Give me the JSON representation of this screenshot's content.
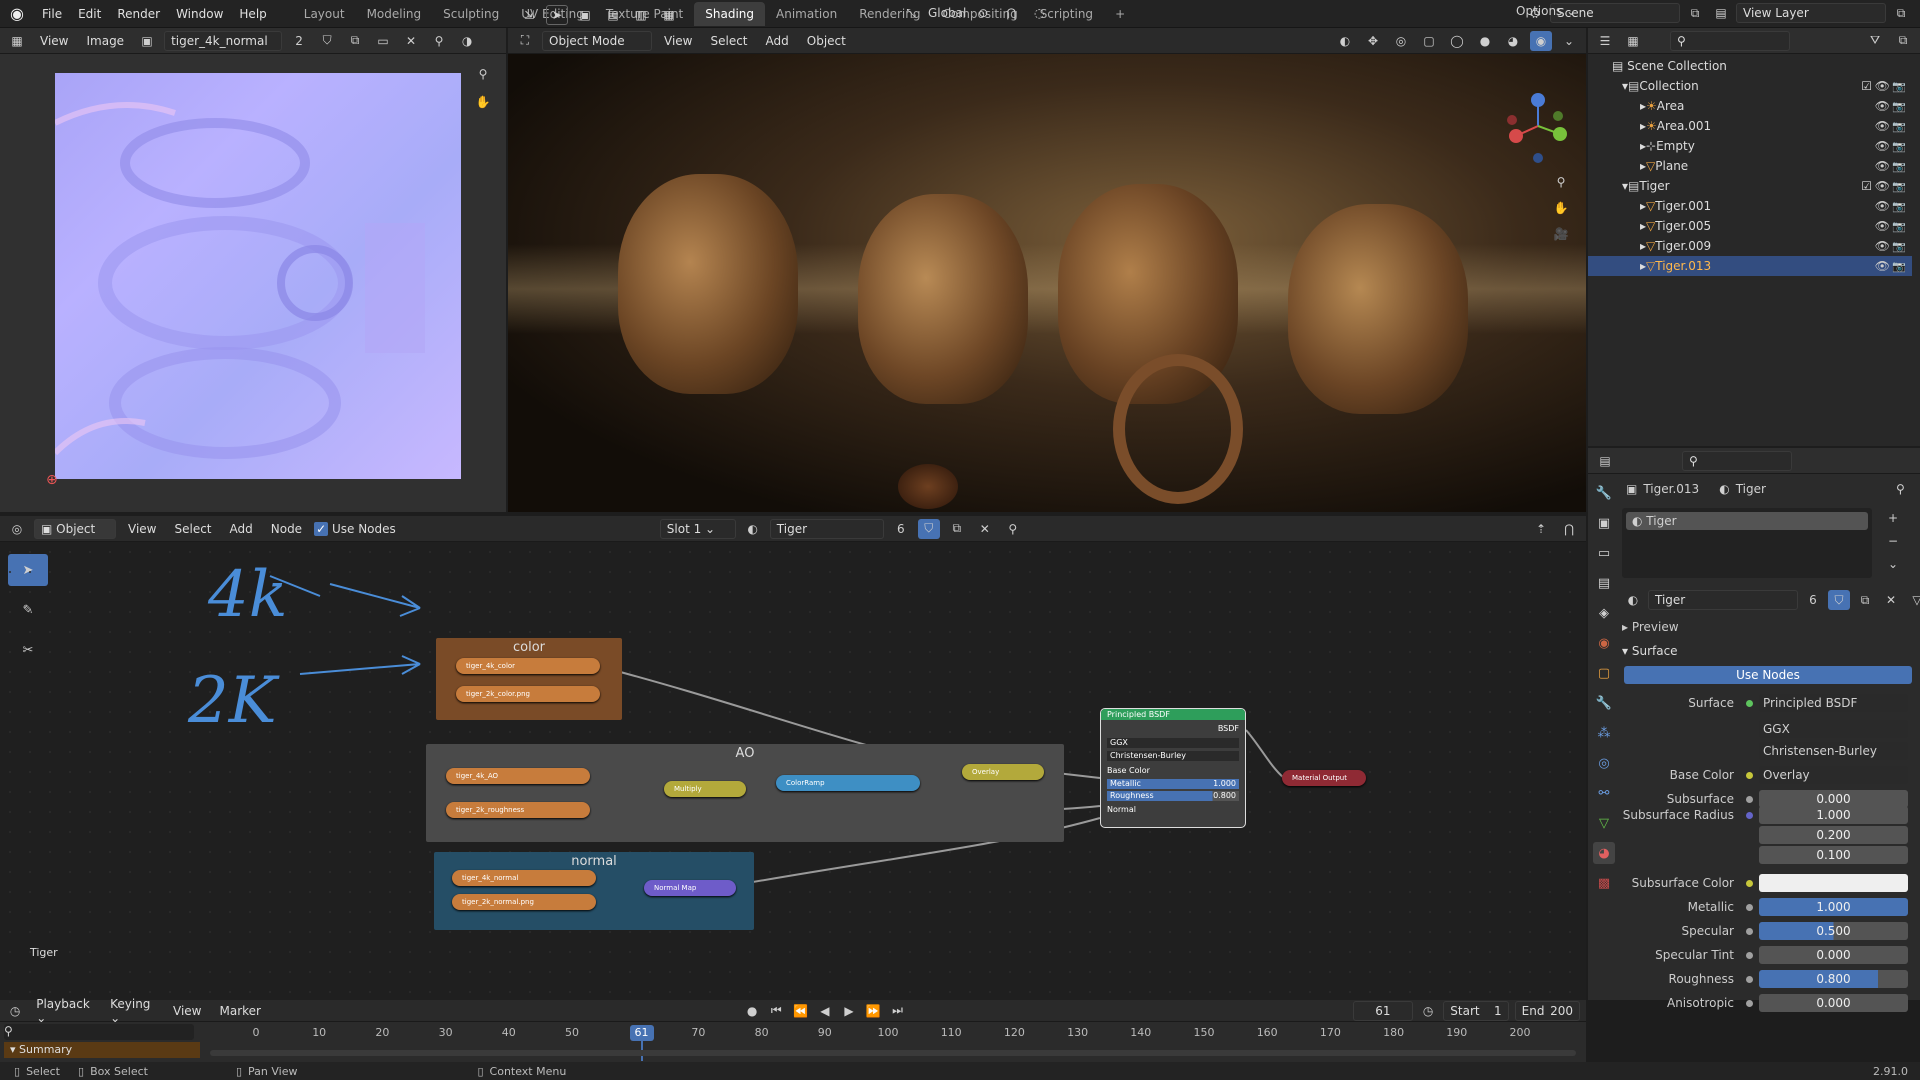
{
  "app": {
    "menus": [
      "File",
      "Edit",
      "Render",
      "Window",
      "Help"
    ]
  },
  "workspaces": {
    "tabs": [
      "Layout",
      "Modeling",
      "Sculpting",
      "UV Editing",
      "Texture Paint",
      "Shading",
      "Animation",
      "Rendering",
      "Compositing",
      "Scripting"
    ],
    "active": "Shading",
    "add": "+"
  },
  "scene": {
    "name": "Scene",
    "view_layer": "View Layer"
  },
  "image_editor": {
    "view": "View",
    "image": "Image",
    "image_name": "tiger_4k_normal",
    "users": "2"
  },
  "viewport": {
    "mode": "Object Mode",
    "menus": [
      "View",
      "Select",
      "Add",
      "Object"
    ],
    "orientation": "Global",
    "options": "Options"
  },
  "outliner": {
    "root": "Scene Collection",
    "items": [
      {
        "name": "Collection",
        "indent": 1,
        "kind": "collection"
      },
      {
        "name": "Area",
        "indent": 2,
        "kind": "light"
      },
      {
        "name": "Area.001",
        "indent": 2,
        "kind": "light"
      },
      {
        "name": "Empty",
        "indent": 2,
        "kind": "empty"
      },
      {
        "name": "Plane",
        "indent": 2,
        "kind": "mesh"
      },
      {
        "name": "Tiger",
        "indent": 1,
        "kind": "collection"
      },
      {
        "name": "Tiger.001",
        "indent": 2,
        "kind": "mesh"
      },
      {
        "name": "Tiger.005",
        "indent": 2,
        "kind": "mesh"
      },
      {
        "name": "Tiger.009",
        "indent": 2,
        "kind": "mesh"
      },
      {
        "name": "Tiger.013",
        "indent": 2,
        "kind": "mesh",
        "selected": true
      }
    ]
  },
  "node_editor": {
    "editor_type": "Object",
    "menus": [
      "View",
      "Select",
      "Add",
      "Node"
    ],
    "use_nodes": "Use Nodes",
    "slot": "Slot 1",
    "material": "Tiger",
    "users": "6",
    "footer_label": "Tiger",
    "annotation_4k": "4k",
    "annotation_2k": "2K",
    "frames": {
      "color": "color",
      "ao": "AO",
      "normal": "normal"
    },
    "nodes": {
      "tiger_4k_color": "tiger_4k_color",
      "tiger_2k_color": "tiger_2k_color.png",
      "tiger_4k_ao": "tiger_4k_AO",
      "tiger_2k_roughness": "tiger_2k_roughness",
      "multiply": "Multiply",
      "colorramp": "ColorRamp",
      "overlay": "Overlay",
      "tiger_4k_normal": "tiger_4k_normal",
      "tiger_2k_normal": "tiger_2k_normal.png",
      "normal_map": "Normal Map",
      "material_output": "Material Output",
      "bsdf_title": "Principled BSDF",
      "bsdf_out": "BSDF",
      "bsdf_dist": "GGX",
      "bsdf_sss": "Christensen-Burley",
      "bsdf_base": "Base Color",
      "bsdf_metallic": "Metallic",
      "bsdf_metallic_val": "1.000",
      "bsdf_rough": "Roughness",
      "bsdf_rough_val": "0.800",
      "bsdf_normal": "Normal"
    }
  },
  "properties": {
    "object": "Tiger.013",
    "material": "Tiger",
    "slot_item": "Tiger",
    "users": "6",
    "preview": "Preview",
    "surface_panel": "Surface",
    "use_nodes": "Use Nodes",
    "surface_label": "Surface",
    "surface_value": "Principled BSDF",
    "distribution": "GGX",
    "sss_method": "Christensen-Burley",
    "rows": [
      {
        "label": "Base Color",
        "value": "Overlay",
        "kind": "link"
      },
      {
        "label": "Subsurface",
        "value": "0.000",
        "kind": "num"
      },
      {
        "label": "Subsurface Radius",
        "value": "1.000",
        "kind": "num"
      },
      {
        "label": "",
        "value": "0.200",
        "kind": "num"
      },
      {
        "label": "",
        "value": "0.100",
        "kind": "num"
      },
      {
        "label": "Subsurface Color",
        "value": "",
        "kind": "color"
      },
      {
        "label": "Metallic",
        "value": "1.000",
        "kind": "blue",
        "fill": 1.0
      },
      {
        "label": "Specular",
        "value": "0.500",
        "kind": "blue",
        "fill": 0.5
      },
      {
        "label": "Specular Tint",
        "value": "0.000",
        "kind": "num"
      },
      {
        "label": "Roughness",
        "value": "0.800",
        "kind": "blue",
        "fill": 0.8
      },
      {
        "label": "Anisotropic",
        "value": "0.000",
        "kind": "num"
      }
    ]
  },
  "timeline": {
    "menus": [
      "Playback",
      "Keying",
      "View",
      "Marker"
    ],
    "current": "61",
    "start_label": "Start",
    "start": "1",
    "end_label": "End",
    "end": "200",
    "ticks": [
      "0",
      "10",
      "20",
      "30",
      "40",
      "50",
      "61",
      "70",
      "80",
      "90",
      "100",
      "110",
      "120",
      "130",
      "140",
      "150",
      "160",
      "170",
      "180",
      "190",
      "200"
    ],
    "summary": "Summary"
  },
  "statusbar": {
    "select": "Select",
    "box_select": "Box Select",
    "pan_view": "Pan View",
    "context_menu": "Context Menu",
    "version": "2.91.0"
  },
  "colors": {
    "accent": "#4772b3",
    "orange_node": "#c77c3c",
    "selected_row": "#334d80",
    "image_node": "#b8633a"
  }
}
